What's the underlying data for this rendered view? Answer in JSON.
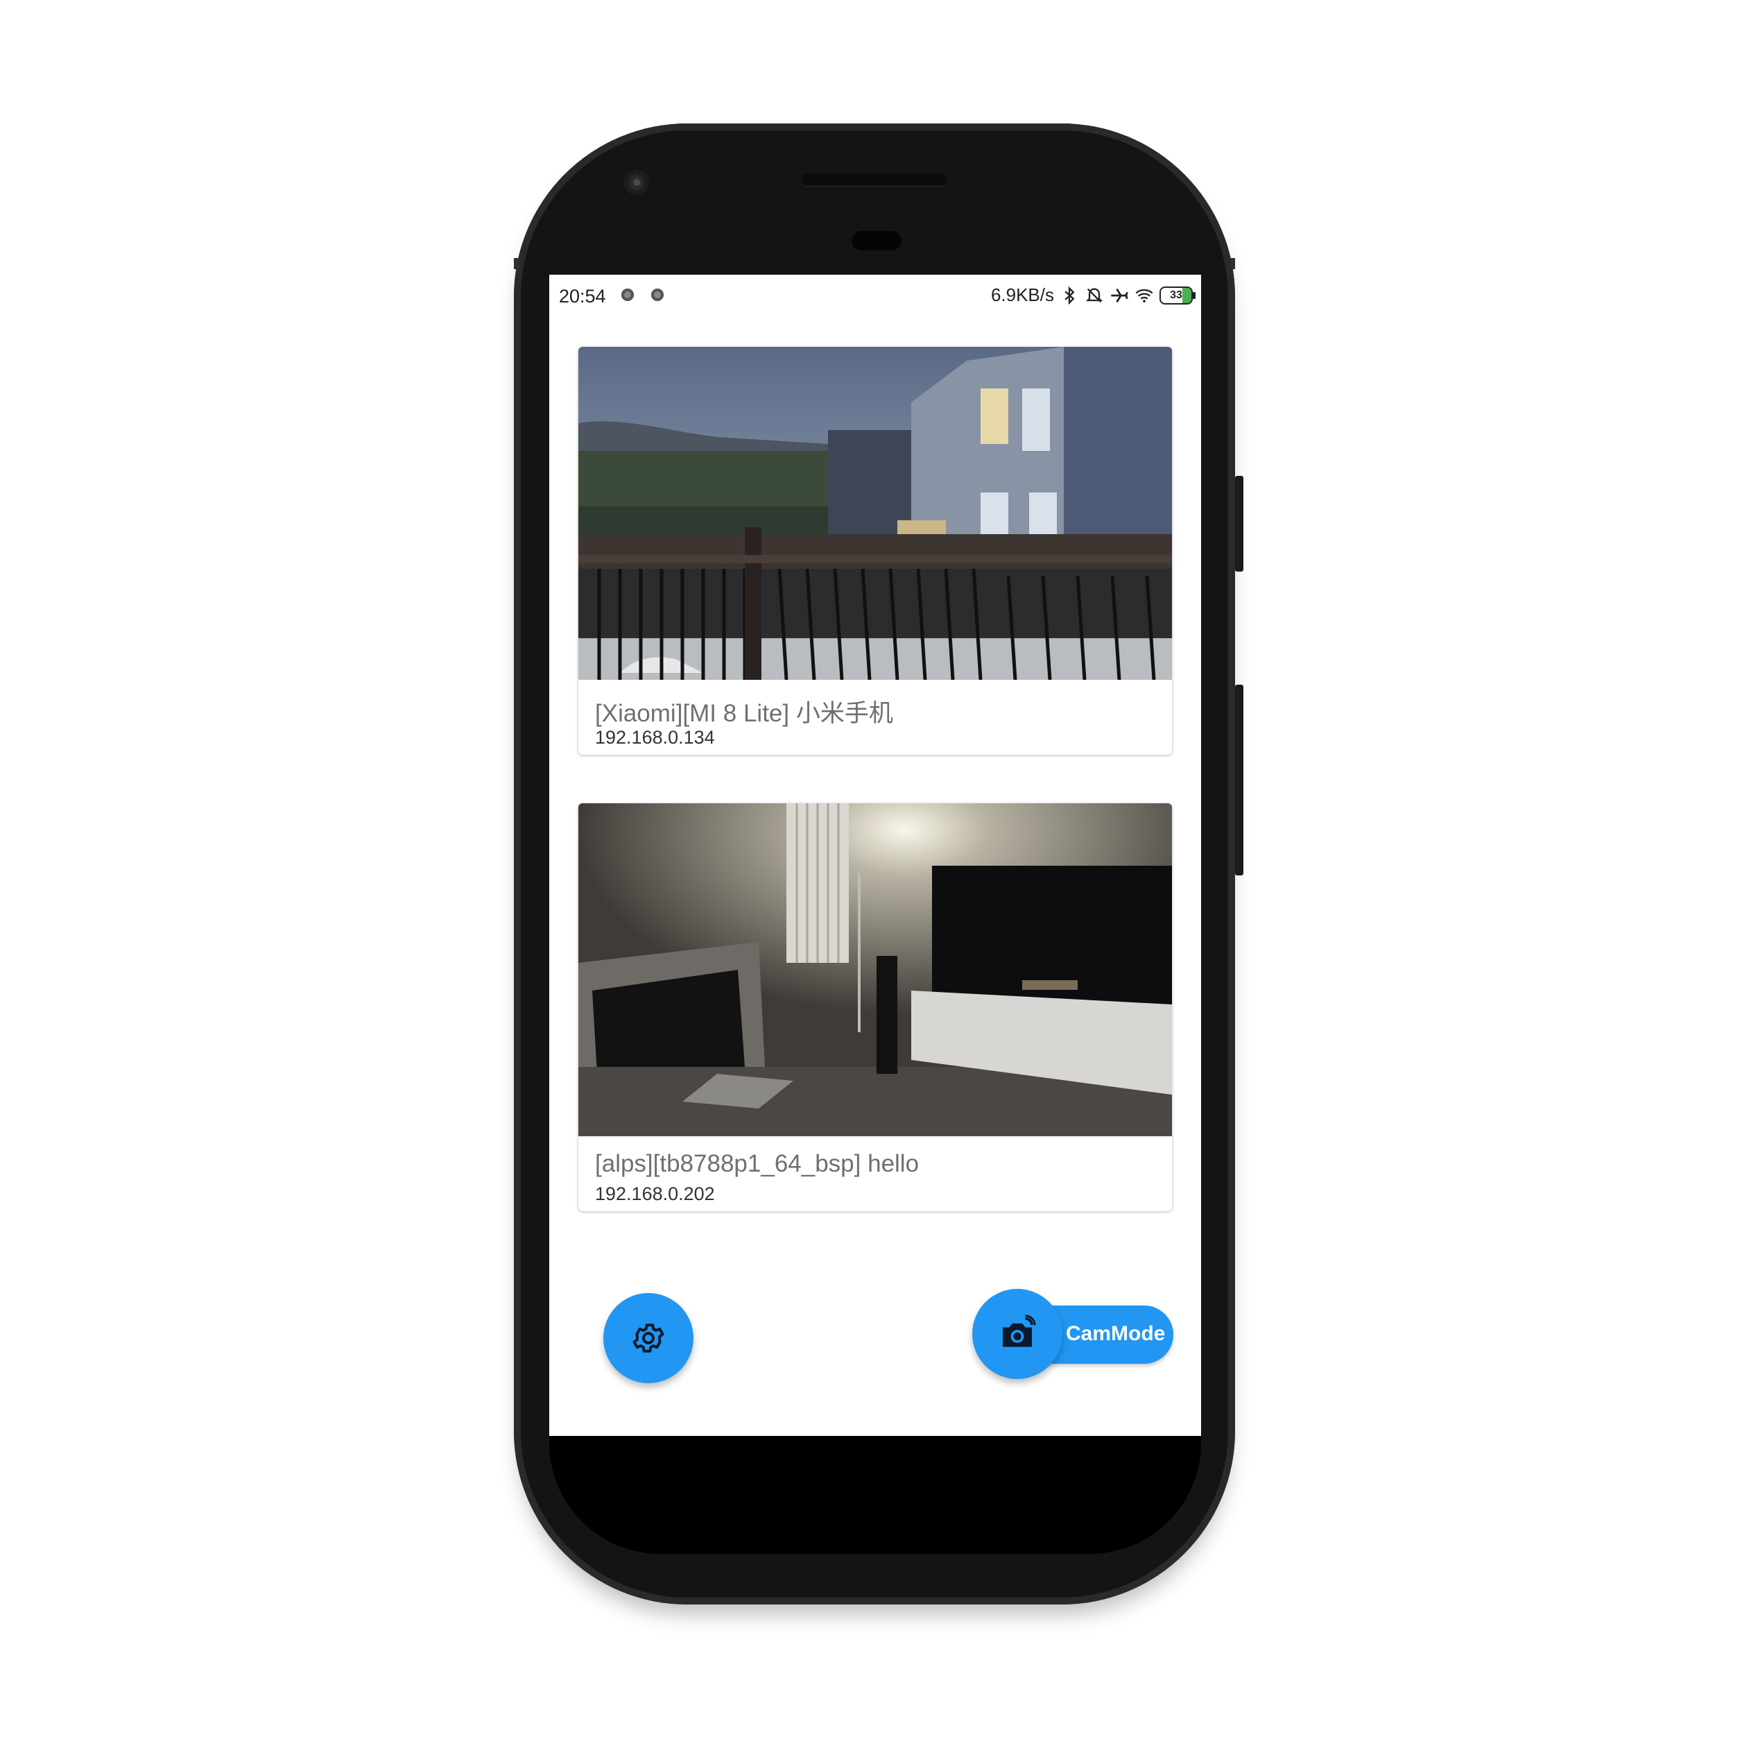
{
  "status_bar": {
    "time": "20:54",
    "network_speed": "6.9KB/s",
    "battery_level": "33",
    "icons": [
      "notification-dot-icon",
      "notification-dot-icon",
      "bluetooth-icon",
      "alarm-off-icon",
      "airplane-icon",
      "wifi-icon",
      "battery-icon"
    ]
  },
  "devices": [
    {
      "title": "[Xiaomi][MI 8 Lite] 小米手机",
      "ip": "192.168.0.134",
      "thumbnail": "balcony-evening-camera-feed"
    },
    {
      "title": "[alps][tb8788p1_64_bsp] hello",
      "ip": "192.168.0.202",
      "thumbnail": "living-room-camera-feed"
    }
  ],
  "actions": {
    "settings_icon": "gear-icon",
    "cam_mode_label": "CamMode",
    "cam_mode_icon": "camera-switch-icon"
  },
  "colors": {
    "accent": "#2196f3",
    "phone_body": "#141414",
    "card_title": "#6f6f6f"
  }
}
